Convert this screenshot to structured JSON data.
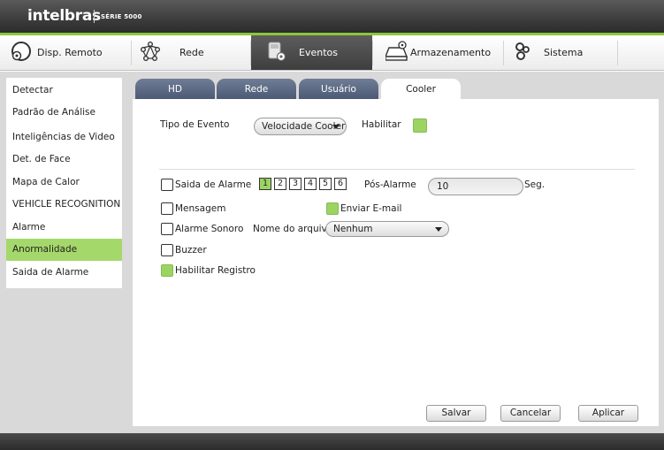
{
  "header": {
    "brand": "intelbras",
    "series": "SÉRIE 5000"
  },
  "nav": [
    {
      "label": "Disp. Remoto",
      "icon": "remote-device-icon"
    },
    {
      "label": "Rede",
      "icon": "network-icon"
    },
    {
      "label": "Eventos",
      "icon": "events-icon",
      "active": true
    },
    {
      "label": "Armazenamento",
      "icon": "storage-icon"
    },
    {
      "label": "Sistema",
      "icon": "system-gears-icon"
    }
  ],
  "sidebar": {
    "items": [
      {
        "label": "Detectar"
      },
      {
        "label": "Padrão de Análise"
      },
      {
        "label": "Inteligências de Video"
      },
      {
        "label": "Det. de Face"
      },
      {
        "label": "Mapa de Calor"
      },
      {
        "label": "VEHICLE RECOGNITION"
      },
      {
        "label": "Alarme"
      },
      {
        "label": "Anormalidade",
        "active": true
      },
      {
        "label": "Saida de Alarme"
      }
    ]
  },
  "tabs": [
    {
      "label": "HD"
    },
    {
      "label": "Rede"
    },
    {
      "label": "Usuário"
    },
    {
      "label": "Cooler",
      "active": true
    }
  ],
  "form": {
    "event_type_label": "Tipo de Evento",
    "event_type_value": "Velocidade Cooler",
    "enable_label": "Habilitar",
    "enable_checked": true,
    "alarm_output_label": "Saida de Alarme",
    "alarm_output_checked": false,
    "alarm_channels": [
      {
        "label": "1",
        "selected": true
      },
      {
        "label": "2",
        "selected": false
      },
      {
        "label": "3",
        "selected": false
      },
      {
        "label": "4",
        "selected": false
      },
      {
        "label": "5",
        "selected": false
      },
      {
        "label": "6",
        "selected": false
      }
    ],
    "post_alarm_label": "Pós-Alarme",
    "post_alarm_value": "10",
    "post_alarm_unit": "Seg.",
    "message_label": "Mensagem",
    "message_checked": false,
    "email_label": "Enviar E-mail",
    "email_checked": true,
    "alarm_sound_label": "Alarme Sonoro",
    "alarm_sound_checked": false,
    "file_name_label": "Nome do arquivo",
    "file_name_value": "Nenhum",
    "buzzer_label": "Buzzer",
    "buzzer_checked": false,
    "log_label": "Habilitar Registro",
    "log_checked": true
  },
  "buttons": {
    "save": "Salvar",
    "cancel": "Cancelar",
    "apply": "Aplicar"
  },
  "colors": {
    "accent": "#8cc63f",
    "active_item": "#a5d86b",
    "tab": "#5c6985",
    "checked": "#9cd462"
  }
}
